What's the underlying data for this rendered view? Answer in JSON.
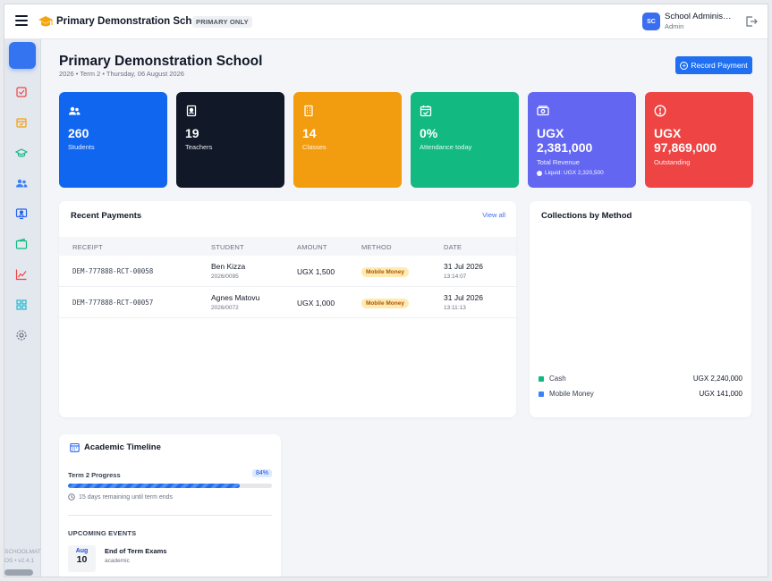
{
  "topbar": {
    "school_name": "Primary Demonstration School",
    "tier_badge": "PRIMARY ONLY",
    "avatar_initials": "SC",
    "user_name": "School Administrator",
    "user_role": "Admin"
  },
  "sidebar": {
    "items": [
      "dashboard-icon",
      "check-square-icon",
      "calendar-icon",
      "graduation-cap-icon",
      "users-icon",
      "teacher-board-icon",
      "wallet-icon",
      "line-chart-icon",
      "grid-icon",
      "settings-icon"
    ],
    "footer_line1": "SCHOOLMAT",
    "footer_line2": "OS • v2.4.1"
  },
  "header": {
    "title": "Primary Demonstration School",
    "subtitle": "2026 • Term 2 • Thursday, 06 August 2026",
    "record_payment_label": "Record Payment"
  },
  "stats": [
    {
      "icon": "users-icon",
      "value": "260",
      "label": "Students",
      "color": "#1166f0"
    },
    {
      "icon": "id-badge-icon",
      "value": "19",
      "label": "Teachers",
      "color": "#111827"
    },
    {
      "icon": "building-icon",
      "value": "14",
      "label": "Classes",
      "color": "#f29c0f"
    },
    {
      "icon": "calendar-check-icon",
      "value": "0%",
      "label": "Attendance today",
      "color": "#12b981"
    },
    {
      "icon": "cash-icon",
      "value_line1": "UGX",
      "value_line2": "2,381,000",
      "label": "Total Revenue",
      "note": "Liquid: UGX 2,320,500",
      "color": "#6366f1"
    },
    {
      "icon": "alert-circle-icon",
      "value_line1": "UGX",
      "value_line2": "97,869,000",
      "label": "Outstanding",
      "color": "#ee4444"
    }
  ],
  "recent_payments": {
    "title": "Recent Payments",
    "view_all": "View all",
    "columns": [
      "RECEIPT",
      "STUDENT",
      "AMOUNT",
      "METHOD",
      "DATE"
    ],
    "rows": [
      {
        "receipt": "DEM-777888-RCT-00058",
        "student": "Ben Kizza",
        "student_id": "2026/0095",
        "amount": "UGX 1,500",
        "method": "Mobile Money",
        "date": "31 Jul 2026",
        "time": "13:14:07"
      },
      {
        "receipt": "DEM-777888-RCT-00057",
        "student": "Agnes Matovu",
        "student_id": "2026/0072",
        "amount": "UGX 1,000",
        "method": "Mobile Money",
        "date": "31 Jul 2026",
        "time": "13:11:13"
      }
    ]
  },
  "collections": {
    "title": "Collections by Method",
    "items": [
      {
        "name": "Cash",
        "value": "UGX 2,240,000",
        "color": "#10b981"
      },
      {
        "name": "Mobile Money",
        "value": "UGX 141,000",
        "color": "#3b82f6"
      }
    ]
  },
  "timeline": {
    "title": "Academic Timeline",
    "progress_label": "Term 2 Progress",
    "progress_pct_text": "84%",
    "progress_fraction": 0.84,
    "days_remaining": "15 days remaining until term ends",
    "upcoming_label": "UPCOMING EVENTS",
    "events": [
      {
        "month": "Aug",
        "day": "10",
        "name": "End of Term Exams",
        "category": "academic"
      }
    ]
  }
}
